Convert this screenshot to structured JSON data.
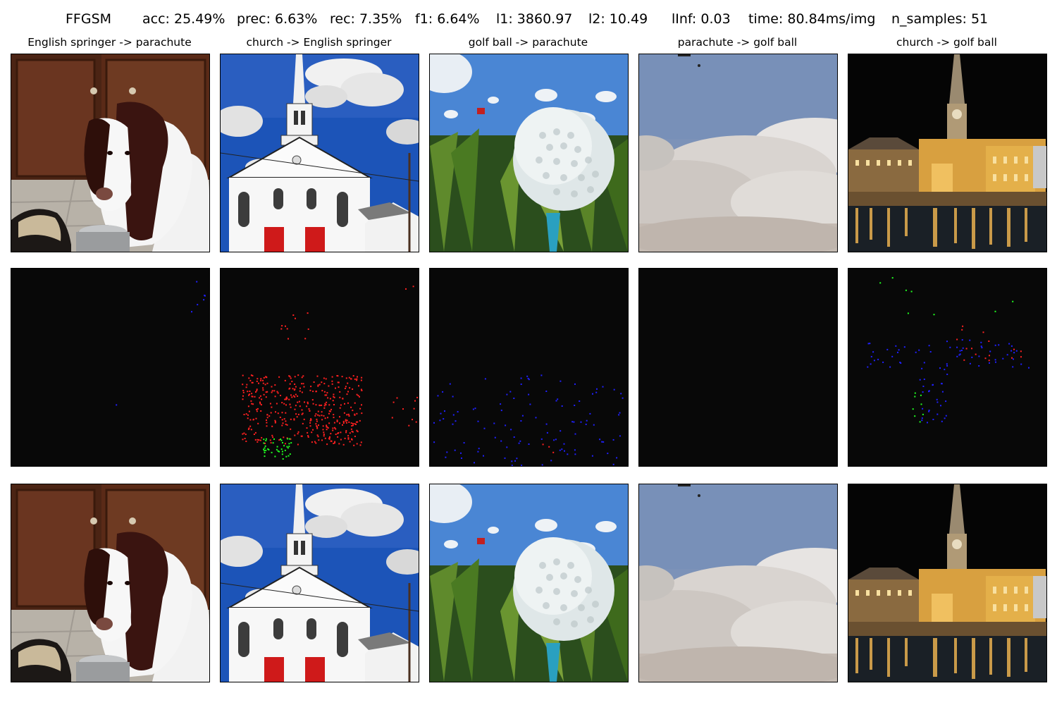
{
  "header": {
    "method": "FFGSM",
    "acc": "acc: 25.49%",
    "prec": "prec: 6.63%",
    "rec": "rec: 7.35%",
    "f1": "f1: 6.64%",
    "l1": "l1: 3860.97",
    "l2": "l2: 10.49",
    "linf": "lInf: 0.03",
    "time": "time: 80.84ms/img",
    "n_samples": "n_samples: 51"
  },
  "columns": [
    {
      "title": "English springer -> parachute",
      "subject": "dog-photo"
    },
    {
      "title": "church -> English springer",
      "subject": "church-photo"
    },
    {
      "title": "golf ball -> parachute",
      "subject": "golf-ball-photo"
    },
    {
      "title": "parachute -> golf ball",
      "subject": "sky-photo"
    },
    {
      "title": "church -> golf ball",
      "subject": "night-church-photo"
    }
  ],
  "rows": [
    "original",
    "perturbation",
    "adversarial"
  ],
  "colors": {
    "noise_background": "#080808",
    "noise_red": "#ff2020",
    "noise_green": "#20ff20",
    "noise_blue": "#2020ff"
  }
}
